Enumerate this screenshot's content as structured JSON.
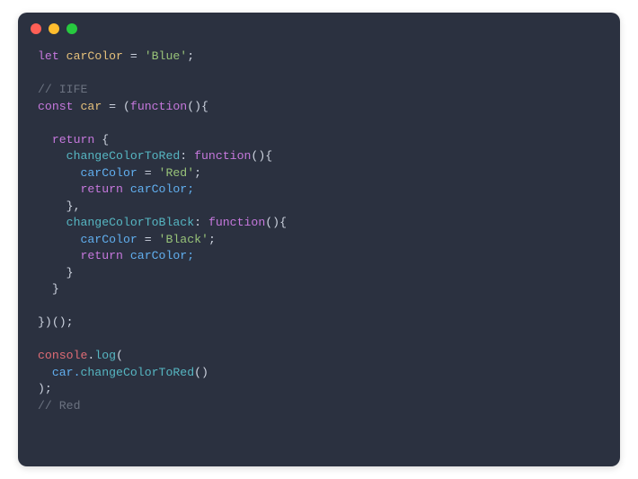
{
  "traffic": {
    "red": "#ff5f56",
    "yellow": "#ffbd2e",
    "green": "#27c93f"
  },
  "code": {
    "l1a": "let",
    "l1b": " carColor ",
    "l1c": "=",
    "l1d": " 'Blue'",
    "l1e": ";",
    "l3a": "// IIFE",
    "l4a": "const",
    "l4b": " car ",
    "l4c": "=",
    "l4d": " (",
    "l4e": "function",
    "l4f": "(){",
    "l6a": "  return",
    "l6b": " {",
    "l7a": "    changeColorToRed",
    "l7b": ": ",
    "l7c": "function",
    "l7d": "(){",
    "l8a": "      carColor ",
    "l8b": "=",
    "l8c": " 'Red'",
    "l8d": ";",
    "l9a": "      return",
    "l9b": " carColor;",
    "l10a": "    },",
    "l11a": "    changeColorToBlack",
    "l11b": ": ",
    "l11c": "function",
    "l11d": "(){",
    "l12a": "      carColor ",
    "l12b": "=",
    "l12c": " 'Black'",
    "l12d": ";",
    "l13a": "      return",
    "l13b": " carColor;",
    "l14a": "    }",
    "l15a": "  }",
    "l17a": "})();",
    "l19a": "console",
    "l19b": ".",
    "l19c": "log",
    "l19d": "(",
    "l20a": "  car.",
    "l20b": "changeColorToRed",
    "l20c": "()",
    "l21a": ");",
    "l22a": "// Red"
  }
}
